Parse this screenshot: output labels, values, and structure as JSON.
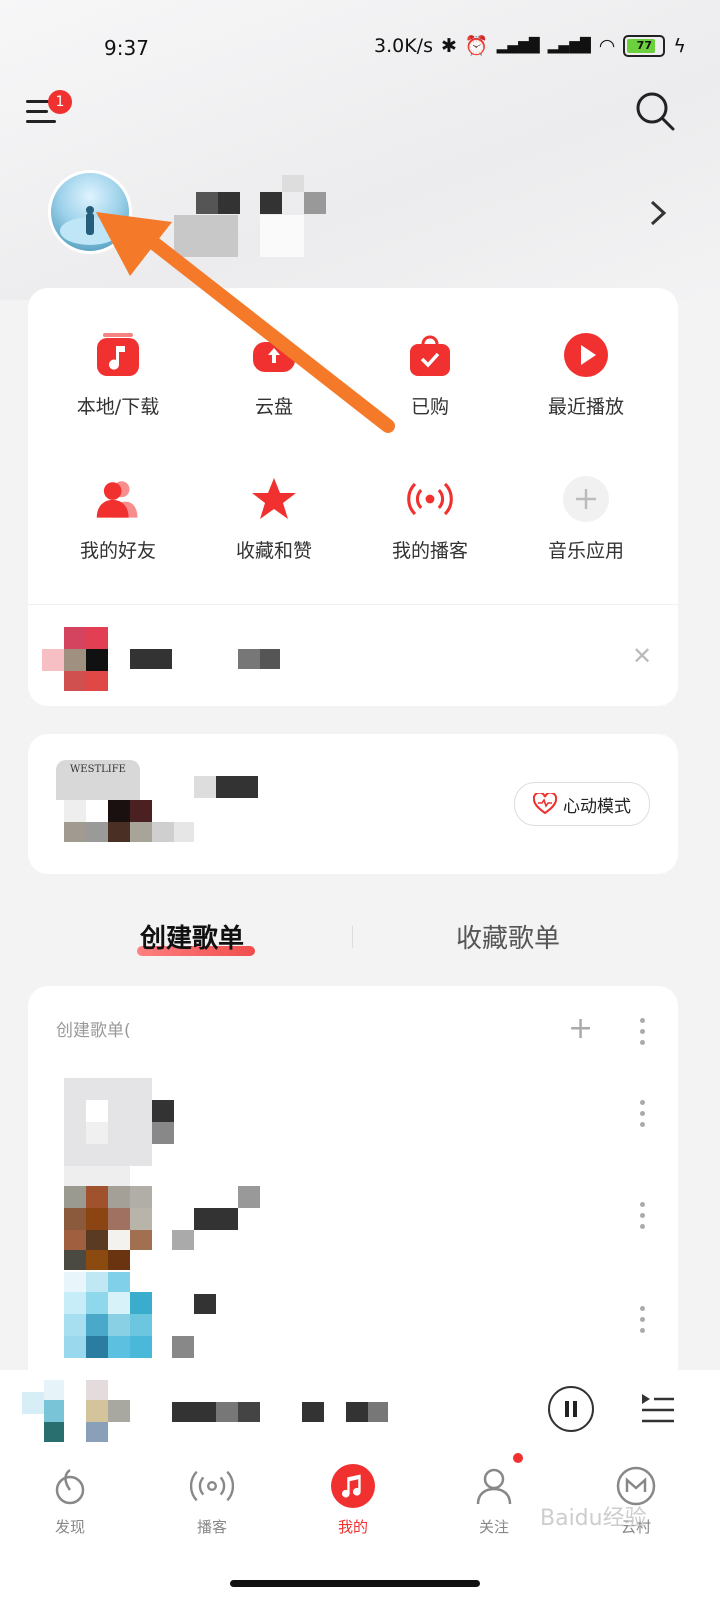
{
  "status_bar": {
    "time": "9:37",
    "net_speed": "3.0K/s",
    "battery": "77"
  },
  "header": {
    "badge_count": "1"
  },
  "quick_grid": [
    {
      "label": "本地/下载",
      "icon": "music-note-icon"
    },
    {
      "label": "云盘",
      "icon": "cloud-upload-icon"
    },
    {
      "label": "已购",
      "icon": "shopping-bag-icon"
    },
    {
      "label": "最近播放",
      "icon": "play-icon"
    },
    {
      "label": "我的好友",
      "icon": "friends-icon"
    },
    {
      "label": "收藏和赞",
      "icon": "star-icon"
    },
    {
      "label": "我的播客",
      "icon": "broadcast-icon"
    },
    {
      "label": "音乐应用",
      "icon": "plus-icon"
    }
  ],
  "heart_mode": {
    "label": "心动模式",
    "album_text": "WESTLIFE"
  },
  "playlist_tabs": {
    "created": "创建歌单",
    "collected": "收藏歌单"
  },
  "list_header": "创建歌单(",
  "nav": [
    {
      "label": "发现",
      "icon": "discover-icon"
    },
    {
      "label": "播客",
      "icon": "podcast-icon"
    },
    {
      "label": "我的",
      "icon": "my-music-icon"
    },
    {
      "label": "关注",
      "icon": "follow-icon"
    },
    {
      "label": "云村",
      "icon": "village-icon"
    }
  ],
  "colors": {
    "accent": "#f0312f",
    "annotation_arrow": "#f47a2a"
  },
  "watermark": "Baidu经验 jingyan.baidu.com"
}
